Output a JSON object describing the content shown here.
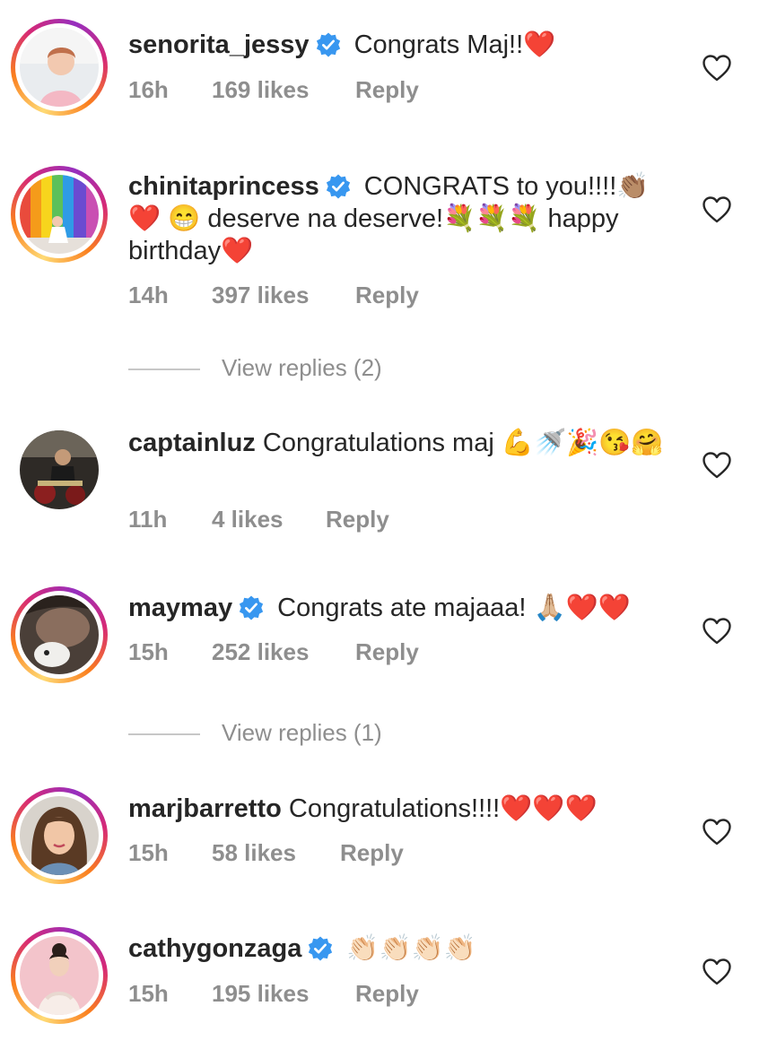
{
  "comments": [
    {
      "username": "senorita_jessy",
      "verified": true,
      "text": " Congrats Maj!!❤️",
      "time": "16h",
      "likes": "169 likes",
      "reply": "Reply"
    },
    {
      "username": "chinitaprincess",
      "verified": true,
      "text": " CONGRATS to you!!!!👏🏽❤️ 😁 deserve na deserve!💐💐💐 happy birthday❤️",
      "time": "14h",
      "likes": "397 likes",
      "reply": "Reply",
      "view_replies": "View replies (2)"
    },
    {
      "username": "captainluz",
      "verified": false,
      "text": " Congratulations maj 💪🚿🎉😘🤗",
      "time": "11h",
      "likes": "4 likes",
      "reply": "Reply"
    },
    {
      "username": "maymay",
      "verified": true,
      "text": " Congrats ate majaaa! 🙏🏼❤️❤️",
      "time": "15h",
      "likes": "252 likes",
      "reply": "Reply",
      "view_replies": "View replies (1)"
    },
    {
      "username": "marjbarretto",
      "verified": false,
      "text": " Congratulations!!!!❤️❤️❤️",
      "time": "15h",
      "likes": "58 likes",
      "reply": "Reply"
    },
    {
      "username": "cathygonzaga",
      "verified": true,
      "text": " 👏🏻👏🏻👏🏻👏🏻",
      "time": "15h",
      "likes": "195 likes",
      "reply": "Reply"
    }
  ],
  "colors": {
    "verified": "#3897f0",
    "muted": "#8e8e8e",
    "text": "#262626",
    "heart": "#ed4956"
  },
  "icons": {
    "like": "heart-outline-icon",
    "verified": "verified-badge-icon"
  }
}
